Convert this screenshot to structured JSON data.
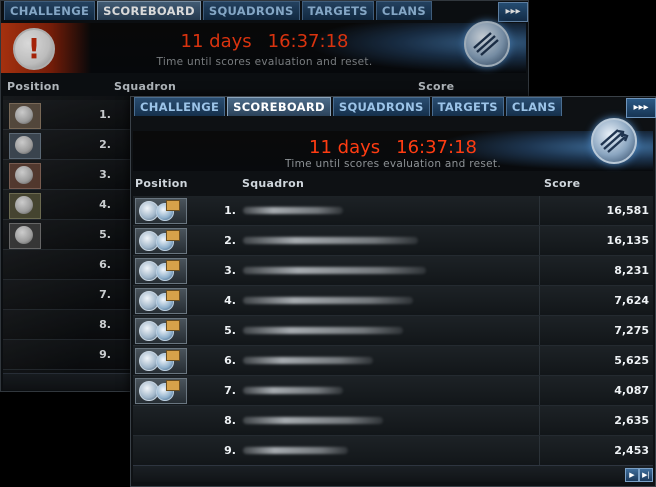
{
  "tabs": [
    "CHALLENGE",
    "SCOREBOARD",
    "SQUADRONS",
    "TARGETS",
    "CLANS"
  ],
  "more_label": "▸▸▸",
  "timer": {
    "days": "11 days",
    "time": "16:37:18",
    "subtitle": "Time until scores evaluation and reset."
  },
  "columns": {
    "position": "Position",
    "squadron": "Squadron",
    "score": "Score"
  },
  "rows": [
    {
      "pos": "1.",
      "score": "16,581"
    },
    {
      "pos": "2.",
      "score": "16,135"
    },
    {
      "pos": "3.",
      "score": "8,231"
    },
    {
      "pos": "4.",
      "score": "7,624"
    },
    {
      "pos": "5.",
      "score": "7,275"
    },
    {
      "pos": "6.",
      "score": "5,625"
    },
    {
      "pos": "7.",
      "score": "4,087"
    },
    {
      "pos": "8.",
      "score": "2,635"
    },
    {
      "pos": "9.",
      "score": "2,453"
    }
  ],
  "back_window": {
    "timer": {
      "days": "11 days",
      "time": "16:37:18",
      "subtitle": "Time until scores evaluation and reset."
    },
    "alert_glyph": "!"
  },
  "colors": {
    "timer": "#ff3c12",
    "tab_active": "#4d6b88",
    "tab": "#2a4d70"
  },
  "icons": [
    "squadron-emblem-icon",
    "alert-icon",
    "clan-flag-icon",
    "page-next-icon",
    "page-last-icon"
  ]
}
